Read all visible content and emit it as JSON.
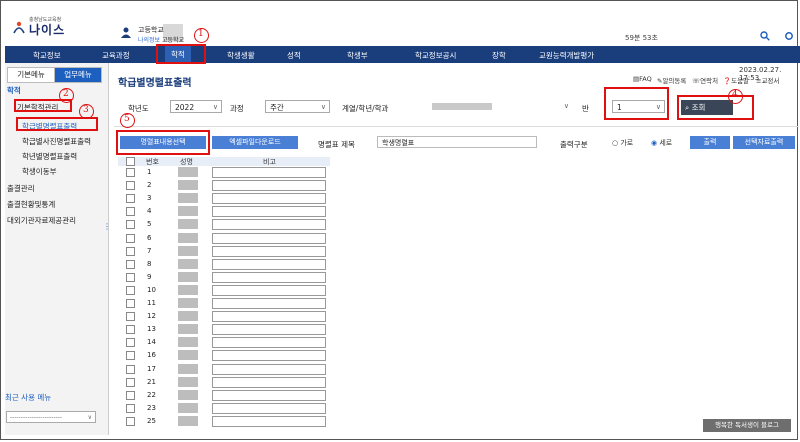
{
  "header": {
    "logo_sub": "충청남도교육청",
    "logo_text": "나이스",
    "user_school": "고등학교",
    "user_sub_a": "나의정보",
    "user_sub_b": "고등학교",
    "session": "59분 53초"
  },
  "nav": {
    "items": [
      "학교정보",
      "교육과정",
      "학적",
      "학생생활",
      "성적",
      "학생부",
      "학교정보공시",
      "장학",
      "교원능력개발평가"
    ]
  },
  "sidebar": {
    "tabs": [
      "기본메뉴",
      "업무메뉴"
    ],
    "title": "학적",
    "group": "기본학적관리",
    "items": [
      "학급별명렬표출력",
      "학급별사진명렬표출력",
      "학년별명렬표출력",
      "학생이동부"
    ],
    "sections": [
      "출결관리",
      "출결현황및통계",
      "대외기관자료제공관리"
    ],
    "recent_label": "최근 사용 메뉴",
    "recent_select": "------------------------"
  },
  "main": {
    "title": "학급별명렬표출력",
    "datetime": "2023.02.27. 17:53",
    "util": [
      "FAQ",
      "알의동록",
      "연락처",
      "도움말",
      "교정서"
    ],
    "filters": {
      "grade_year_label": "학년도",
      "grade_year_value": "2022",
      "course_label": "과정",
      "course_value": "주간",
      "dept_label": "계열/학년/학과",
      "class_label": "반",
      "class_value": "1",
      "query_label": "조회"
    },
    "toolbar": {
      "select_content_btn": "명렬표내용선택",
      "excel_btn": "엑셀파일다운로드",
      "title_label": "명렬표 제목",
      "title_value": "학생명렬표",
      "output_label": "출력구분",
      "landscape": "가로",
      "portrait": "세로",
      "print_btn": "출력",
      "selected_print_btn": "선택자료출력"
    },
    "table": {
      "headers": [
        "번호",
        "성명",
        "비고"
      ],
      "rows": [
        "1",
        "2",
        "3",
        "4",
        "5",
        "6",
        "7",
        "8",
        "9",
        "10",
        "11",
        "12",
        "13",
        "14",
        "16",
        "17",
        "21",
        "22",
        "23",
        "25"
      ]
    }
  },
  "annotations": [
    "1",
    "2",
    "3",
    "4",
    "5"
  ],
  "watermark": "행복한 독서생이 블로그",
  "colors": {
    "nav_bg": "#1a3d7c",
    "accent": "#1d5fbf",
    "annotation": "#e01010",
    "button": "#4a7fd6"
  }
}
